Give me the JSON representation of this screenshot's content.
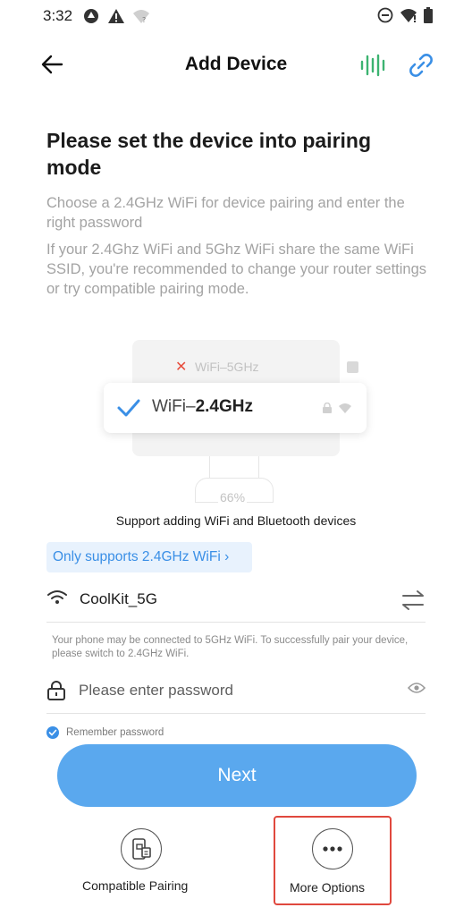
{
  "status_bar": {
    "time": "3:32",
    "left_icons": [
      "sync-icon",
      "warning-icon",
      "wifi-question-icon"
    ],
    "right_icons": [
      "do-not-disturb-icon",
      "wifi-full-icon",
      "battery-icon"
    ]
  },
  "app_bar": {
    "title": "Add Device",
    "back_icon": "arrow-left-icon",
    "actions": [
      "voice-wave-icon",
      "link-icon"
    ],
    "accent_green": "#3cb371",
    "accent_blue": "#3a8fe6"
  },
  "main": {
    "heading": "Please set the device into pairing mode",
    "desc1": "Choose a 2.4GHz WiFi for device pairing and enter the right password",
    "desc2": "If your 2.4Ghz WiFi and 5Ghz WiFi share the same WiFi SSID, you're recommended to change your router settings or try compatible pairing mode."
  },
  "illustration": {
    "wifi_5g_label": "WiFi–5GHz",
    "wifi_24_prefix": "WiFi–",
    "wifi_24_bold": "2.4GHz",
    "progress_text": "66%",
    "progress": 0.66
  },
  "support_text": "Support adding WiFi and Bluetooth devices",
  "only_supports": {
    "label": "Only supports 2.4GHz WiFi",
    "chevron": "›"
  },
  "wifi": {
    "ssid": "CoolKit_5G",
    "hint": "Your phone may be connected to 5GHz WiFi. To successfully pair your device, please switch to 2.4GHz WiFi."
  },
  "password": {
    "value": "",
    "placeholder": "Please enter password"
  },
  "remember": {
    "label": "Remember password",
    "checked": true
  },
  "next_label": "Next",
  "options": {
    "compatible_label": "Compatible Pairing",
    "more_label": "More Options",
    "highlight_color": "#e0483e"
  },
  "colors": {
    "primary_button": "#5aa8ee",
    "muted_text": "#a3a3a3"
  }
}
